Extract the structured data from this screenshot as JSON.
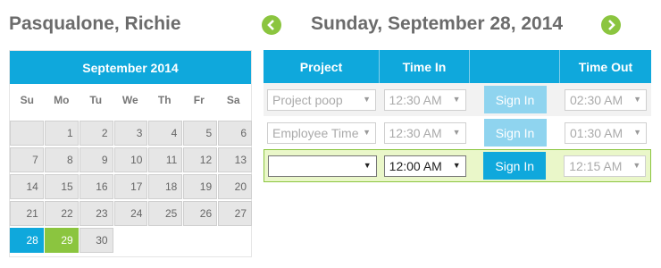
{
  "user": {
    "name": "Pasqualone, Richie"
  },
  "date_nav": {
    "title": "Sunday, September 28, 2014",
    "prev_icon": "chevron-left-icon",
    "next_icon": "chevron-right-icon"
  },
  "calendar": {
    "month_label": "September 2014",
    "weekdays": [
      "Su",
      "Mo",
      "Tu",
      "We",
      "Th",
      "Fr",
      "Sa"
    ],
    "weeks": [
      [
        "",
        "1",
        "2",
        "3",
        "4",
        "5",
        "6"
      ],
      [
        "7",
        "8",
        "9",
        "10",
        "11",
        "12",
        "13"
      ],
      [
        "14",
        "15",
        "16",
        "17",
        "18",
        "19",
        "20"
      ],
      [
        "21",
        "22",
        "23",
        "24",
        "25",
        "26",
        "27"
      ],
      [
        "28",
        "29",
        "30",
        "",
        "",
        "",
        ""
      ]
    ],
    "today": "28",
    "selected": "29"
  },
  "table": {
    "headers": [
      "Project",
      "Time In",
      "",
      "Time Out"
    ],
    "rows": [
      {
        "project": "Project poop",
        "time_in": "12:30 AM",
        "action": "Sign In",
        "time_out": "02:30 AM"
      },
      {
        "project": "Employee Time",
        "time_in": "12:30 AM",
        "action": "Sign In",
        "time_out": "01:30 AM"
      },
      {
        "project": "",
        "time_in": "12:00 AM",
        "action": "Sign In",
        "time_out": "12:15 AM"
      }
    ]
  },
  "colors": {
    "accent": "#0fa8dc",
    "green": "#8bc53f"
  }
}
